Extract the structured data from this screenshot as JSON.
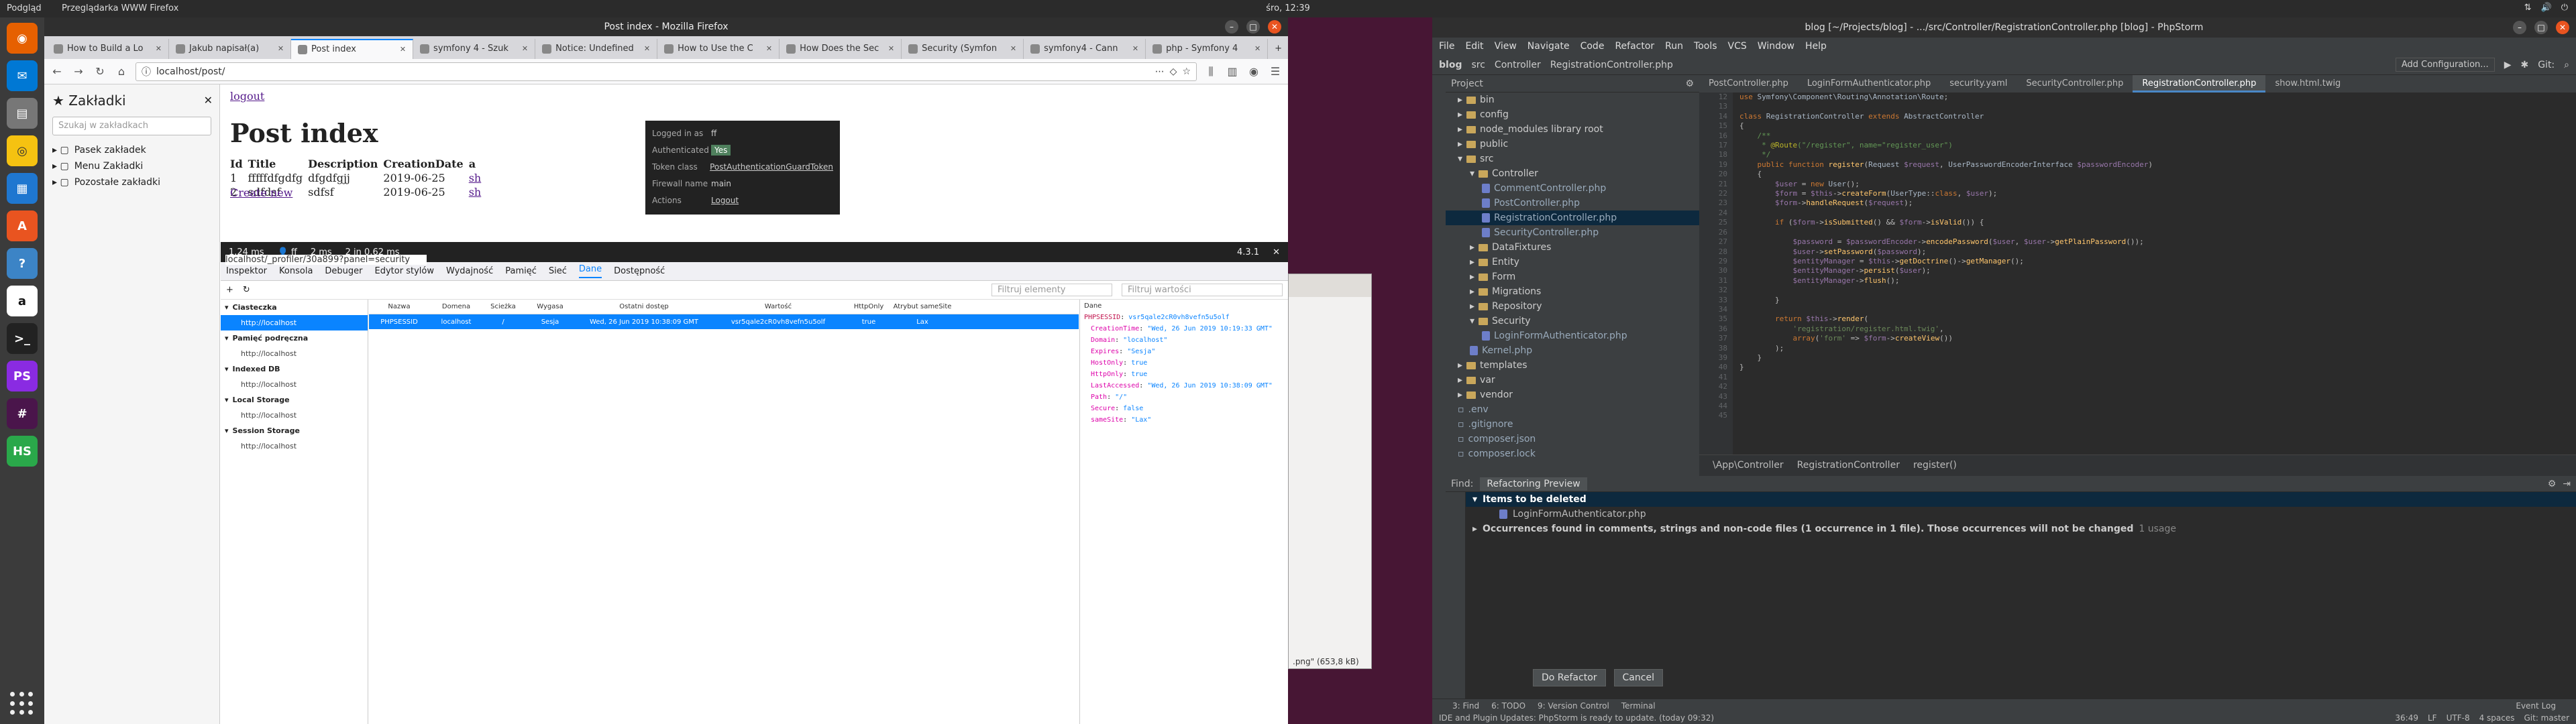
{
  "topbar": {
    "activities": "Podgląd",
    "app": "Przeglądarka WWW Firefox",
    "clock": "śro, 12:39"
  },
  "firefox": {
    "title": "Post index - Mozilla Firefox",
    "tabs": [
      {
        "label": "How to Build a Lo"
      },
      {
        "label": "Jakub napisał(a)"
      },
      {
        "label": "Post index"
      },
      {
        "label": "symfony 4 - Szuk"
      },
      {
        "label": "Notice: Undefined"
      },
      {
        "label": "How to Use the C"
      },
      {
        "label": "How Does the Sec"
      },
      {
        "label": "Security (Symfon"
      },
      {
        "label": "symfony4 - Cann"
      },
      {
        "label": "php - Symfony 4"
      }
    ],
    "url": "localhost/post/",
    "sidebar": {
      "title": "Zakładki",
      "search_placeholder": "Szukaj w zakładkach",
      "items": [
        "Pasek zakładek",
        "Menu Zakładki",
        "Pozostałe zakładki"
      ]
    },
    "page": {
      "logout": "logout",
      "heading": "Post index",
      "columns": [
        "Id",
        "Title",
        "Description",
        "CreationDate",
        "a"
      ],
      "rows": [
        [
          "1",
          "fffffdfgdfg",
          "dfgdfgjj",
          "2019-06-25",
          "sh"
        ],
        [
          "2",
          "sdfdsf",
          "sdfsf",
          "2019-06-25",
          "sh"
        ]
      ],
      "create_link": "Create new"
    },
    "sf_popup": {
      "logged_in_as_k": "Logged in as",
      "logged_in_as_v": "ff",
      "auth_k": "Authenticated",
      "auth_v": "Yes",
      "token_k": "Token class",
      "token_v": "PostAuthenticationGuardToken",
      "firewall_k": "Firewall name",
      "firewall_v": "main",
      "actions_k": "Actions",
      "actions_v": "Logout"
    },
    "sf_bar": {
      "time": "1.24 ms",
      "user": "ff",
      "ms2": "2 ms",
      "db": "2 in 0.62 ms",
      "version": "4.3.1"
    },
    "devtools": {
      "url": "localhost/_profiler/30a899?panel=security",
      "tabs": [
        "Inspektor",
        "Konsola",
        "Debuger",
        "Edytor stylów",
        "Wydajność",
        "Pamięć",
        "Sieć",
        "Dane",
        "Dostępność"
      ],
      "filter_placeholder": "Filtruj elementy",
      "filter_values_placeholder": "Filtruj wartości",
      "tree": [
        {
          "group": "Ciasteczka",
          "child": "http://localhost"
        },
        {
          "group": "Pamięć podręczna",
          "child": "http://localhost"
        },
        {
          "group": "Indexed DB",
          "child": "http://localhost"
        },
        {
          "group": "Local Storage",
          "child": "http://localhost"
        },
        {
          "group": "Session Storage",
          "child": "http://localhost"
        }
      ],
      "table_headers": [
        "Nazwa",
        "Domena",
        "Ścieżka",
        "Wygasa",
        "Ostatni dostęp",
        "Wartość",
        "HttpOnly",
        "Atrybut sameSite"
      ],
      "table_row": [
        "PHPSESSID",
        "localhost",
        "/",
        "Sesja",
        "Wed, 26 Jun 2019 10:38:09 GMT",
        "vsr5qale2cR0vh8vefn5u5olf",
        "true",
        "Lax"
      ],
      "detail_title": "Dane",
      "detail": [
        {
          "k": "PHPSESSID",
          "v": "vsr5qale2cR0vh8vefn5u5olf"
        },
        {
          "k": "CreationTime",
          "v": "\"Wed, 26 Jun 2019 10:19:33 GMT\""
        },
        {
          "k": "Domain",
          "v": "\"localhost\""
        },
        {
          "k": "Expires",
          "v": "\"Sesja\""
        },
        {
          "k": "HostOnly",
          "v": "true"
        },
        {
          "k": "HttpOnly",
          "v": "true"
        },
        {
          "k": "LastAccessed",
          "v": "\"Wed, 26 Jun 2019 10:38:09 GMT\""
        },
        {
          "k": "Path",
          "v": "\"/\""
        },
        {
          "k": "Secure",
          "v": "false"
        },
        {
          "k": "sameSite",
          "v": "\"Lax\""
        }
      ]
    }
  },
  "bgwindow": {
    "footer": ".png\" (653,8 kB)"
  },
  "phpstorm": {
    "title": "blog [~/Projects/blog] - .../src/Controller/RegistrationController.php [blog] - PhpStorm",
    "menu": [
      "File",
      "Edit",
      "View",
      "Navigate",
      "Code",
      "Refactor",
      "Run",
      "Tools",
      "VCS",
      "Window",
      "Help"
    ],
    "nav": [
      "blog",
      "src",
      "Controller",
      "RegistrationController.php"
    ],
    "add_config": "Add Configuration...",
    "git": "Git:",
    "project_label": "Project",
    "tree": [
      {
        "label": "bin",
        "type": "dir",
        "depth": 1
      },
      {
        "label": "config",
        "type": "dir",
        "depth": 1
      },
      {
        "label": "node_modules  library root",
        "type": "dir",
        "depth": 1
      },
      {
        "label": "public",
        "type": "dir",
        "depth": 1
      },
      {
        "label": "src",
        "type": "dir",
        "depth": 1
      },
      {
        "label": "Controller",
        "type": "dir",
        "depth": 2
      },
      {
        "label": "CommentController.php",
        "type": "php",
        "depth": 3
      },
      {
        "label": "PostController.php",
        "type": "php",
        "depth": 3
      },
      {
        "label": "RegistrationController.php",
        "type": "php",
        "depth": 3
      },
      {
        "label": "SecurityController.php",
        "type": "php",
        "depth": 3
      },
      {
        "label": "DataFixtures",
        "type": "dir",
        "depth": 2
      },
      {
        "label": "Entity",
        "type": "dir",
        "depth": 2
      },
      {
        "label": "Form",
        "type": "dir",
        "depth": 2
      },
      {
        "label": "Migrations",
        "type": "dir",
        "depth": 2
      },
      {
        "label": "Repository",
        "type": "dir",
        "depth": 2
      },
      {
        "label": "Security",
        "type": "dir",
        "depth": 2
      },
      {
        "label": "LoginFormAuthenticator.php",
        "type": "php",
        "depth": 3
      },
      {
        "label": "Kernel.php",
        "type": "php",
        "depth": 2
      },
      {
        "label": "templates",
        "type": "dir",
        "depth": 1
      },
      {
        "label": "var",
        "type": "dir",
        "depth": 1
      },
      {
        "label": "vendor",
        "type": "dir",
        "depth": 1
      },
      {
        "label": ".env",
        "type": "file",
        "depth": 1
      },
      {
        "label": ".gitignore",
        "type": "file",
        "depth": 1
      },
      {
        "label": "composer.json",
        "type": "file",
        "depth": 1
      },
      {
        "label": "composer.lock",
        "type": "file",
        "depth": 1
      }
    ],
    "editor_tabs": [
      "PostController.php",
      "LoginFormAuthenticator.php",
      "security.yaml",
      "SecurityController.php",
      "RegistrationController.php",
      "show.html.twig"
    ],
    "line_numbers": "12\n13\n14\n15\n16\n17\n18\n19\n20\n21\n22\n23\n24\n25\n26\n27\n28\n29\n30\n31\n32\n33\n34\n35\n36\n37\n38\n39\n40\n41\n42\n43\n44\n45",
    "breadcrumb": [
      "\\App\\Controller",
      "RegistrationController",
      "register()"
    ],
    "find": {
      "label": "Find:",
      "tab": "Refactoring Preview",
      "items_deleted": "Items to be deleted",
      "file": "LoginFormAuthenticator.php",
      "occurrences": "Occurrences found in comments, strings and non-code files  (1 occurrence in 1 file). Those occurrences will not be changed",
      "usage": "1 usage",
      "do_refactor": "Do Refactor",
      "cancel": "Cancel"
    },
    "toolwindows": [
      "3: Find",
      "6: TODO",
      "9: Version Control",
      "Terminal"
    ],
    "event_log": "Event Log",
    "status": "IDE and Plugin Updates: PhpStorm is ready to update. (today 09:32)",
    "status_right": [
      "36:49",
      "LF",
      "UTF-8",
      "4 spaces",
      "Git: master"
    ]
  }
}
